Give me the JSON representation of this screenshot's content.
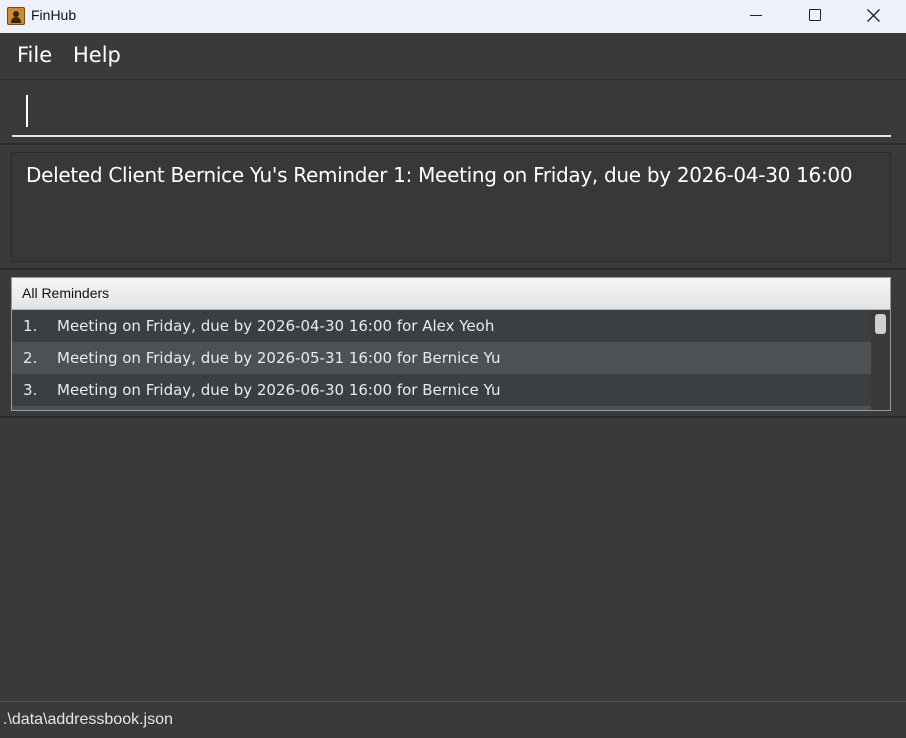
{
  "window": {
    "title": "FinHub",
    "icon": "contact-card-icon"
  },
  "menu": {
    "file": "File",
    "help": "Help"
  },
  "command": {
    "value": "",
    "placeholder": ""
  },
  "result": {
    "message": "Deleted Client Bernice Yu's Reminder 1: Meeting on Friday, due by 2026-04-30 16:00"
  },
  "reminders": {
    "header": "All Reminders",
    "items": [
      {
        "num": "1.",
        "text": "Meeting on Friday, due by 2026-04-30 16:00 for Alex Yeoh"
      },
      {
        "num": "2.",
        "text": "Meeting on Friday, due by 2026-05-31 16:00 for Bernice Yu"
      },
      {
        "num": "3.",
        "text": "Meeting on Friday, due by 2026-06-30 16:00 for Bernice Yu"
      }
    ]
  },
  "status": {
    "path": ".\\data\\addressbook.json"
  },
  "colors": {
    "background": "#3a3a3a",
    "row_odd": "#3c3f41",
    "row_even": "#4d5153",
    "header": "#eaeaea"
  }
}
